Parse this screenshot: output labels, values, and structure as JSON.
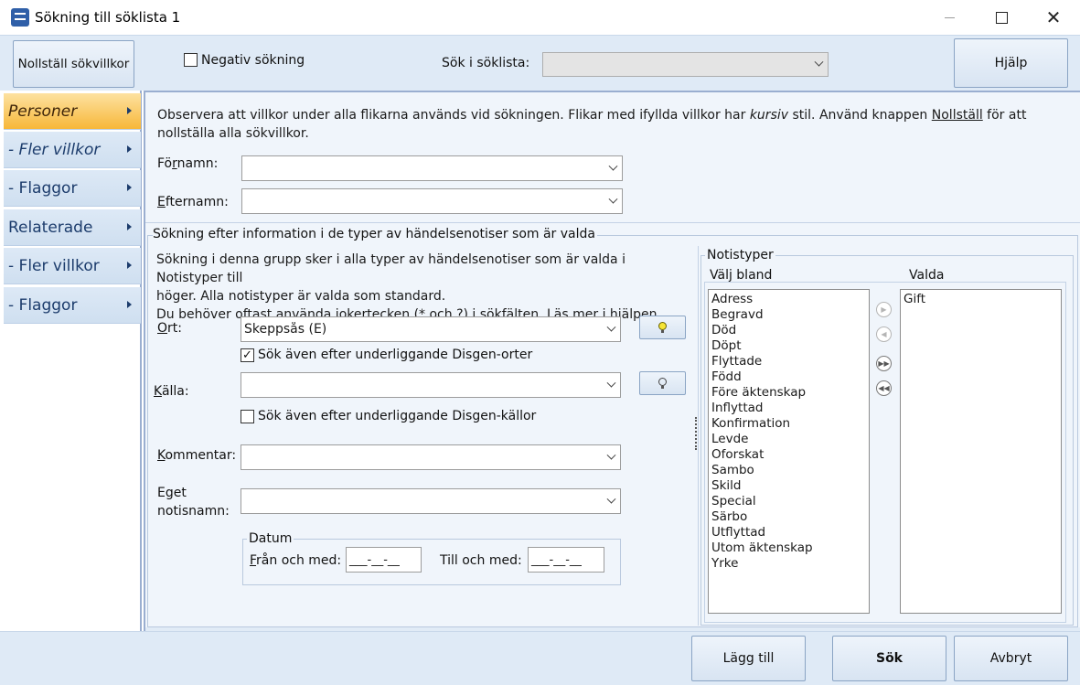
{
  "window": {
    "title": "Sökning till söklista 1",
    "minimize": "—",
    "maximize": "",
    "close": "✕"
  },
  "toolbar": {
    "reset_label": "Nollställ sökvillkor",
    "negative_search_label": "Negativ sökning",
    "negative_search_checked": false,
    "search_in_list_label": "Sök i söklista:",
    "search_in_list_value": "",
    "help_label": "Hjälp"
  },
  "sidebar": {
    "items": [
      {
        "label": "Personer",
        "active": true,
        "italic": true
      },
      {
        "label": "- Fler villkor",
        "active": false,
        "italic": true
      },
      {
        "label": "- Flaggor",
        "active": false,
        "italic": false
      },
      {
        "label": "Relaterade",
        "active": false,
        "italic": false
      },
      {
        "label": "- Fler villkor",
        "active": false,
        "italic": false
      },
      {
        "label": "- Flaggor",
        "active": false,
        "italic": false
      }
    ]
  },
  "notice": {
    "part1": "Observera att villkor under alla flikarna används vid sökningen. Flikar med ifyllda villkor har ",
    "italic": "kursiv",
    "part2": " stil. Använd knappen ",
    "link": "Nollställ",
    "part3": " för att nollställa alla sökvillkor."
  },
  "person": {
    "firstname_label_a": "Fö",
    "firstname_label_u": "r",
    "firstname_label_b": "namn:",
    "firstname_value": "",
    "lastname_label_u": "E",
    "lastname_label_b": "fternamn:",
    "lastname_value": ""
  },
  "event_group": {
    "legend": "Sökning efter information i de typer av händelsenotiser som är valda",
    "text_line1": "Sökning i denna grupp sker i alla typer av händelsenotiser som är valda i Notistyper till",
    "text_line2": "höger. Alla notistyper är valda som standard.",
    "text_line3": "Du behöver oftast använda jokertecken (* och ?) i sökfälten. Läs mer i hjälpen.",
    "place_label_u": "O",
    "place_label_b": "rt:",
    "place_value": "Skeppsås (E)",
    "place_sub_label": "Sök även efter underliggande Disgen-orter",
    "place_sub_checked": true,
    "source_label_u": "K",
    "source_label_b": "älla:",
    "source_value": "",
    "source_sub_label": "Sök även efter underliggande Disgen-källor",
    "source_sub_checked": false,
    "comment_label_u": "K",
    "comment_label_b": "ommentar:",
    "comment_value": "",
    "own_label_1": "Eget",
    "own_label_2": "notisnamn:",
    "own_value": "",
    "date_legend": "Datum",
    "from_label_u": "F",
    "from_label_b": "rån och med:",
    "from_value": "___-__-__",
    "to_label": "Till och med:",
    "to_value": "___-__-__"
  },
  "note_types": {
    "legend": "Notistyper",
    "available_label": "Välj bland",
    "chosen_label": "Valda",
    "available": [
      "Adress",
      "Begravd",
      "Död",
      "Döpt",
      "Flyttade",
      "Född",
      "Före äktenskap",
      "Inflyttad",
      "Konfirmation",
      "Levde",
      "Oforskat",
      "Sambo",
      "Skild",
      "Special",
      "Särbo",
      "Utflyttad",
      "Utom äktenskap",
      "Yrke"
    ],
    "chosen": [
      "Gift"
    ]
  },
  "bottom": {
    "add_label": "Lägg till",
    "search_label": "Sök",
    "cancel_label": "Avbryt"
  }
}
